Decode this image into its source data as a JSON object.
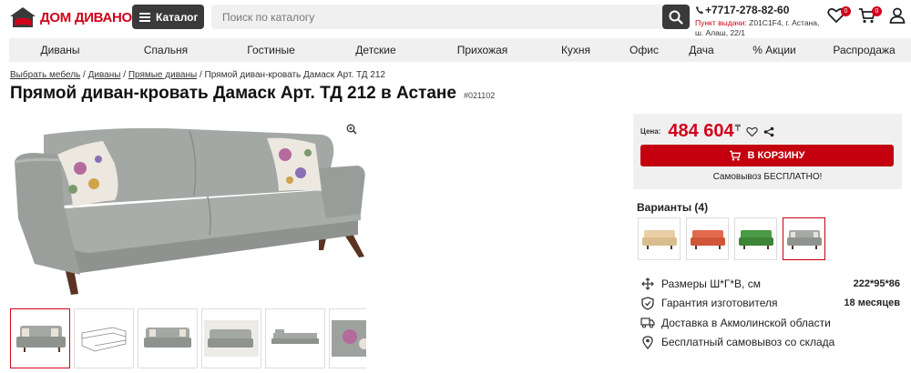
{
  "header": {
    "logo_text": "ДОМ ДИВАНОВ",
    "catalog_label": "Каталог",
    "search_placeholder": "Поиск по каталогу",
    "phone": "+7717-278-82-60",
    "pickup_label": "Пункт выдачи:",
    "pickup_address": " Z01C1F4, г. Астана, ш. Алаш, 22/1",
    "favorites_count": "0",
    "cart_count": "0"
  },
  "nav": [
    {
      "label": "Диваны",
      "state": "active"
    },
    {
      "label": "Спальня",
      "state": ""
    },
    {
      "label": "Гостиные",
      "state": ""
    },
    {
      "label": "Детские",
      "state": ""
    },
    {
      "label": "Прихожая",
      "state": ""
    },
    {
      "label": "Кухня",
      "state": ""
    },
    {
      "label": "Офис",
      "state": ""
    },
    {
      "label": "Дача",
      "state": ""
    },
    {
      "label": "% Акции",
      "state": "gray"
    },
    {
      "label": "Распродажа",
      "state": "gray"
    }
  ],
  "breadcrumb": {
    "items": [
      "Выбрать мебель",
      "Диваны",
      "Прямые диваны"
    ],
    "current": "Прямой диван-кровать Дамаск Арт. ТД 212",
    "separator": " / "
  },
  "product": {
    "title": "Прямой диван-кровать Дамаск Арт. ТД 212 в Астане",
    "sku": "#021102"
  },
  "buy": {
    "price_label": "Цена:",
    "price": "484 604",
    "currency": "₸",
    "cart_label": "В КОРЗИНУ",
    "pickup_text": "Самовывоз БЕСПЛАТНО!"
  },
  "variants": {
    "title": "Варианты (4)",
    "colors": [
      "#e8cfa6",
      "#e36a4e",
      "#4b9a45",
      "#a6aaa7"
    ]
  },
  "specs": [
    {
      "icon": "dimensions-icon",
      "label": "Размеры Ш*Г*В, см",
      "value": "222*95*86"
    },
    {
      "icon": "warranty-shield-icon",
      "label": "Гарантия изготовителя",
      "value": "18 месяцев"
    },
    {
      "icon": "delivery-truck-icon",
      "label": "Доставка в Акмолинской области",
      "value": ""
    },
    {
      "icon": "location-pin-icon",
      "label": "Бесплатный самовывоз со склада",
      "value": ""
    }
  ],
  "colors": {
    "accent": "#d0021b",
    "button": "#c4000f",
    "dark": "#3a3a3a",
    "panel": "#f0f0f0",
    "sofa": "#9ea29f"
  }
}
